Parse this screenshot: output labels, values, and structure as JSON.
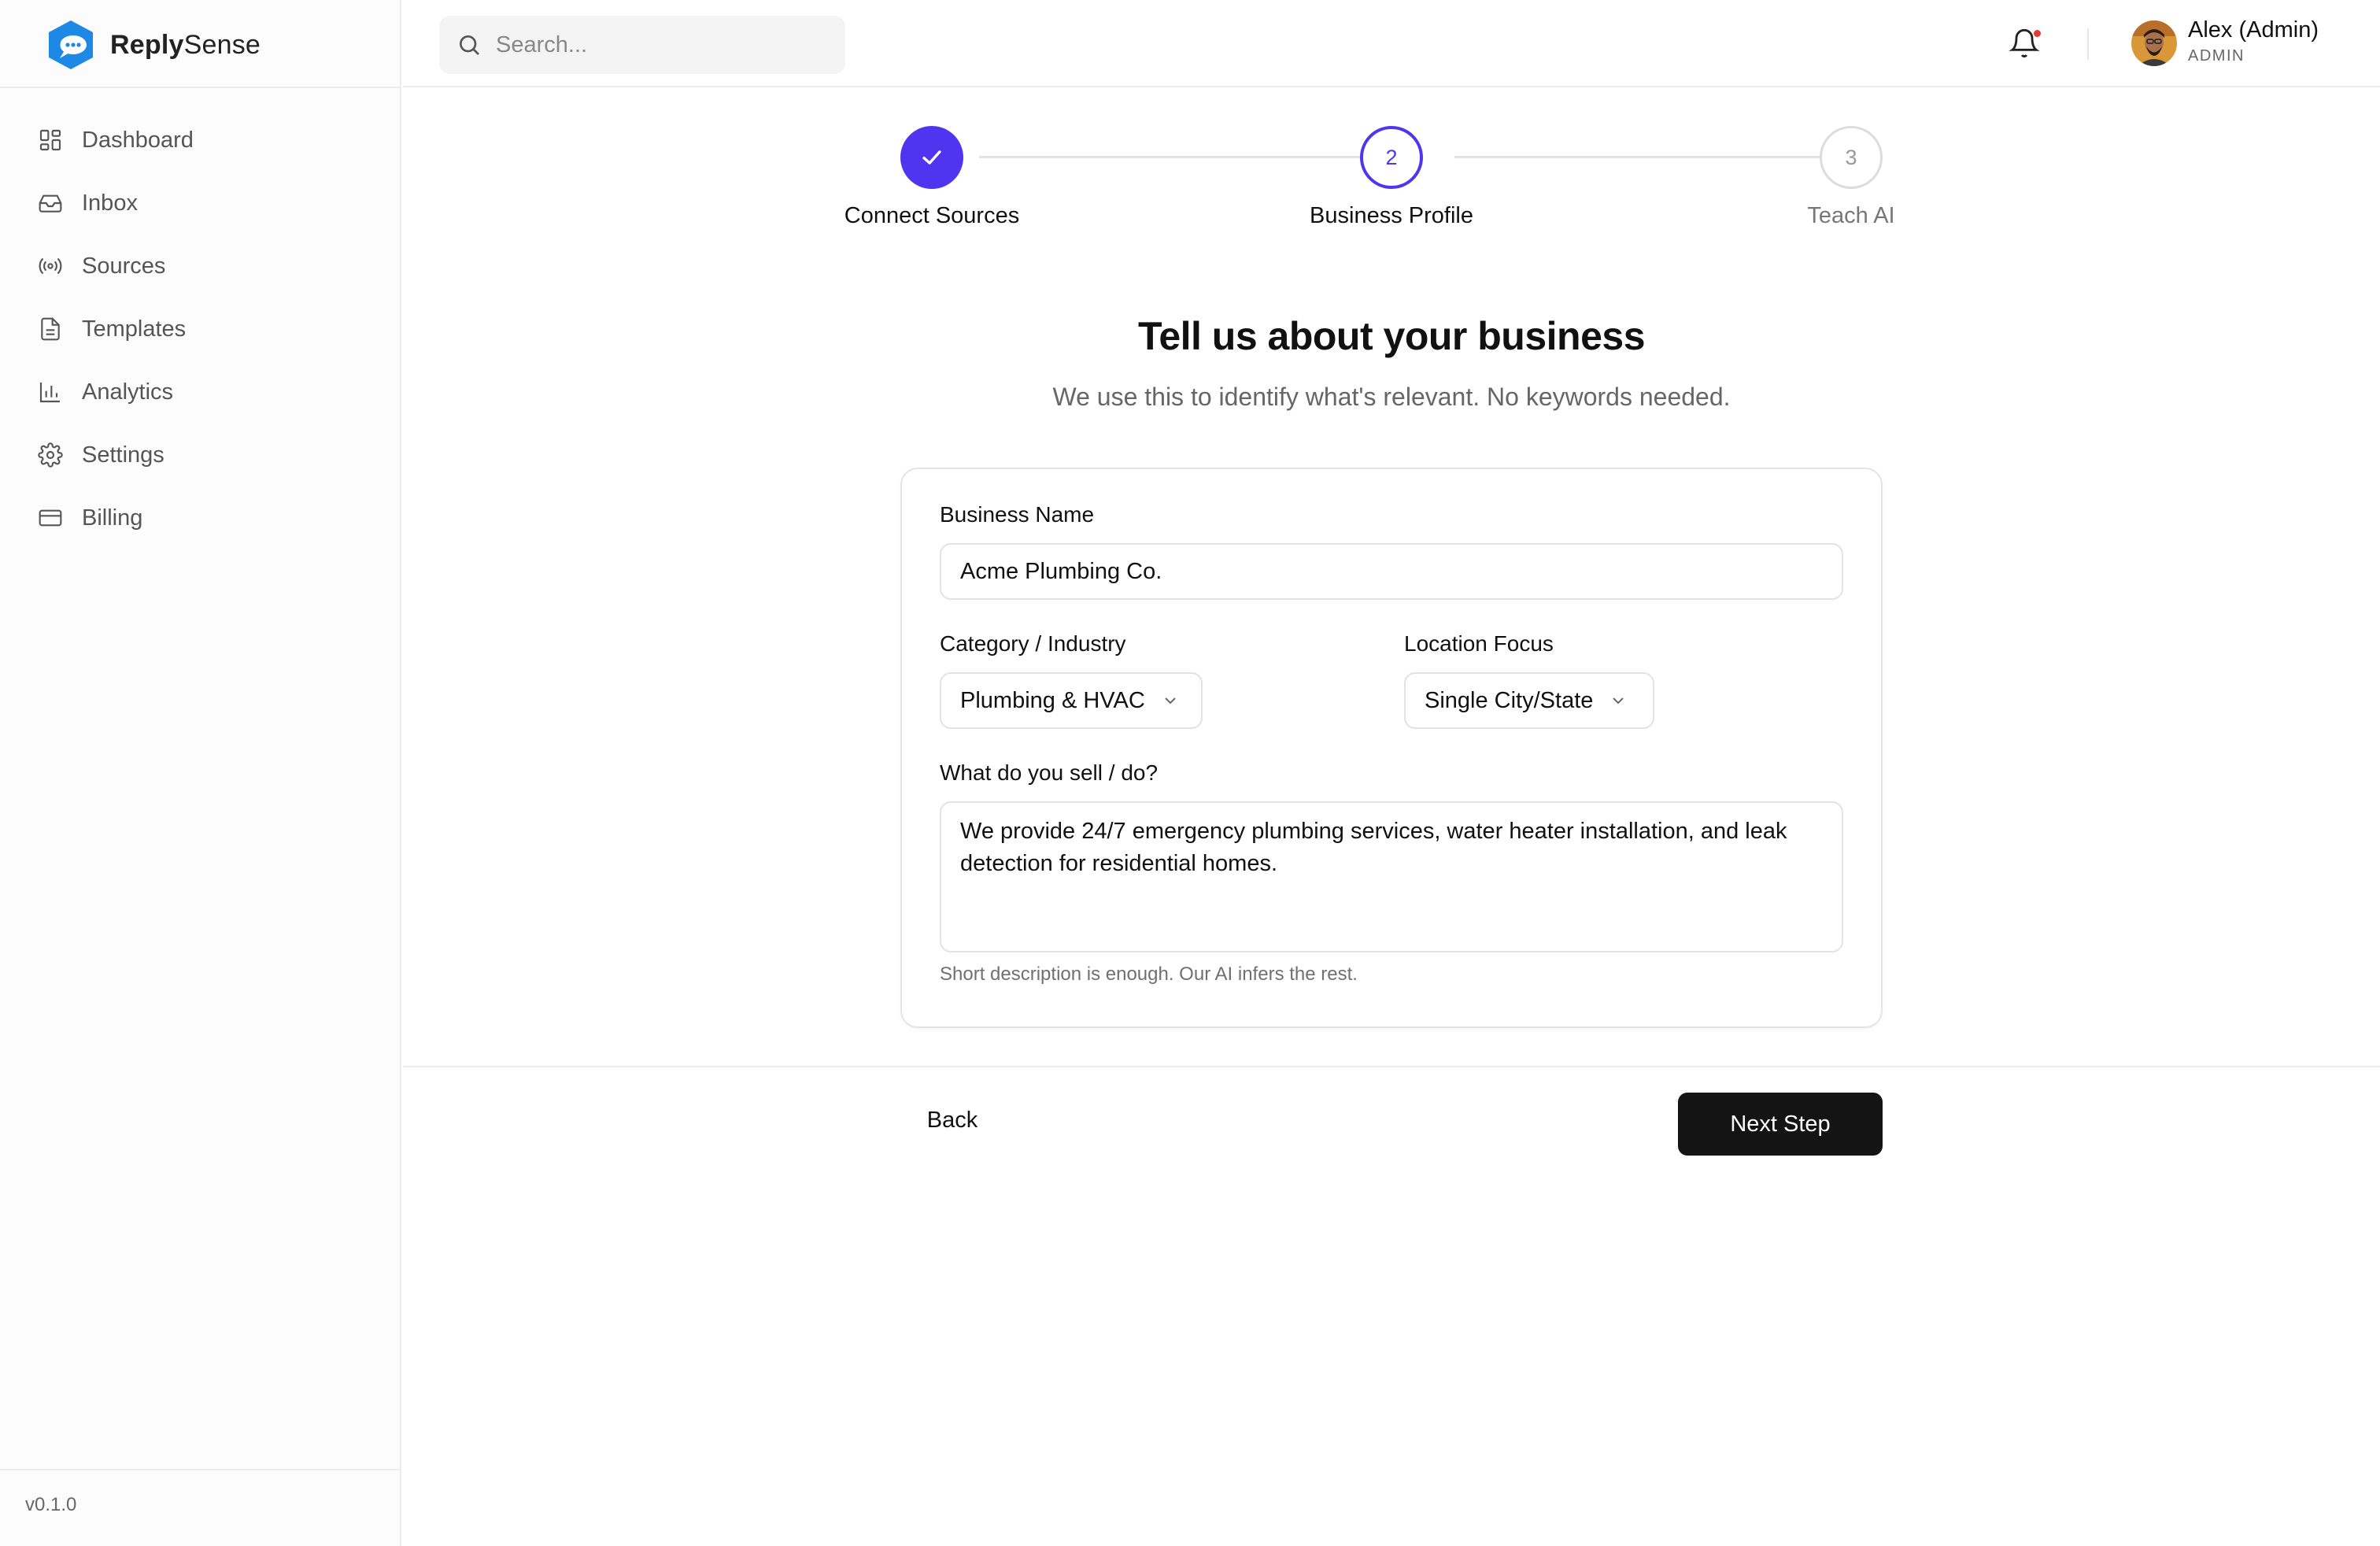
{
  "app": {
    "name_bold": "Reply",
    "name_regular": "Sense",
    "version": "v0.1.0"
  },
  "sidebar": {
    "items": [
      {
        "label": "Dashboard",
        "icon": "dashboard-icon"
      },
      {
        "label": "Inbox",
        "icon": "inbox-icon"
      },
      {
        "label": "Sources",
        "icon": "broadcast-icon"
      },
      {
        "label": "Templates",
        "icon": "document-icon"
      },
      {
        "label": "Analytics",
        "icon": "bar-chart-icon"
      },
      {
        "label": "Settings",
        "icon": "gear-icon"
      },
      {
        "label": "Billing",
        "icon": "credit-card-icon"
      }
    ]
  },
  "header": {
    "search_placeholder": "Search...",
    "user_name": "Alex (Admin)",
    "user_role": "ADMIN",
    "has_notification": true
  },
  "stepper": {
    "steps": [
      {
        "number": "1",
        "label": "Connect Sources",
        "status": "done"
      },
      {
        "number": "2",
        "label": "Business Profile",
        "status": "active"
      },
      {
        "number": "3",
        "label": "Teach AI",
        "status": "todo"
      }
    ]
  },
  "page": {
    "title": "Tell us about your business",
    "subtitle": "We use this to identify what's relevant. No keywords needed."
  },
  "form": {
    "business_name_label": "Business Name",
    "business_name_value": "Acme Plumbing Co.",
    "category_label": "Category / Industry",
    "category_value": "Plumbing & HVAC",
    "location_label": "Location Focus",
    "location_value": "Single City/State",
    "description_label": "What do you sell / do?",
    "description_value": "We provide 24/7 emergency plumbing services, water heater installation, and leak detection for residential homes.",
    "description_hint": "Short description is enough. Our AI infers the rest."
  },
  "actions": {
    "back_label": "Back",
    "next_label": "Next Step"
  },
  "colors": {
    "accent": "#4f35f0",
    "logo_blue": "#1e88e5",
    "primary_button": "#141414",
    "notification_dot": "#e53935"
  }
}
